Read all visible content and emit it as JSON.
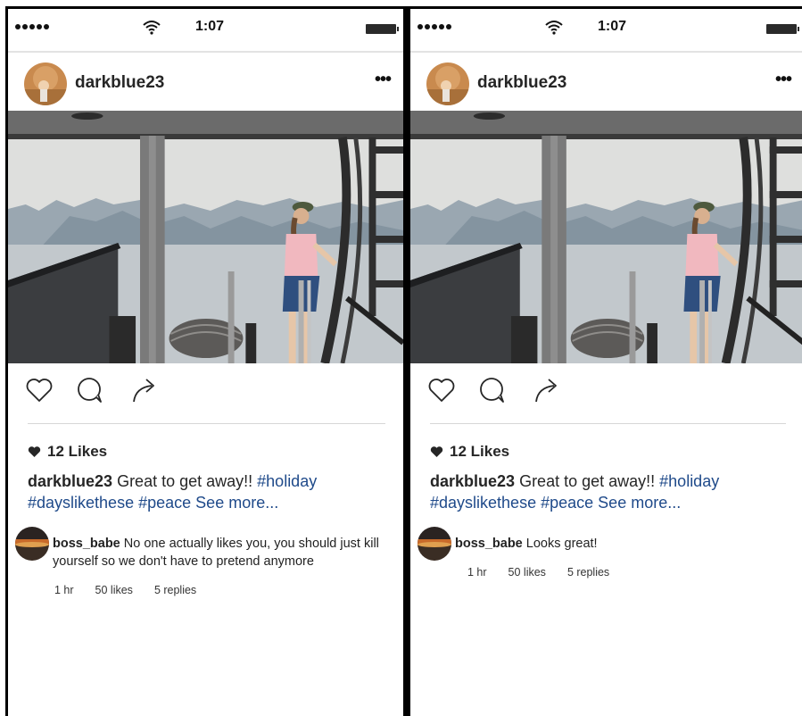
{
  "status_bar": {
    "time": "1:07"
  },
  "posts": [
    {
      "username": "darkblue23",
      "more_label": "•••",
      "likes_label": "12 Likes",
      "caption": {
        "user": "darkblue23",
        "text": "Great to get away!!",
        "tags": [
          "#holiday",
          "#dayslikethese",
          "#peace"
        ],
        "see_more": "See more..."
      },
      "comment": {
        "user": "boss_babe",
        "text": "No one actually likes you, you should just kill yourself so we don't have to pretend anymore",
        "time": "1 hr",
        "likes": "50 likes",
        "replies": "5 replies"
      }
    },
    {
      "username": "darkblue23",
      "more_label": "•••",
      "likes_label": "12 Likes",
      "caption": {
        "user": "darkblue23",
        "text": "Great to get away!!",
        "tags": [
          "#holiday",
          "#dayslikethese",
          "#peace"
        ],
        "see_more": "See more..."
      },
      "comment": {
        "user": "boss_babe",
        "text": "Looks great!",
        "time": "1 hr",
        "likes": "50 likes",
        "replies": "5 replies"
      }
    }
  ],
  "icons": {
    "signal": "signal-dots-icon",
    "wifi": "wifi-icon",
    "battery": "battery-icon",
    "like": "heart-outline-icon",
    "comment": "comment-bubble-icon",
    "share": "share-arrow-icon",
    "likes_heart": "heart-filled-icon"
  },
  "colors": {
    "hashtag": "#1f4a8a",
    "text": "#262626",
    "frame": "#000000"
  }
}
